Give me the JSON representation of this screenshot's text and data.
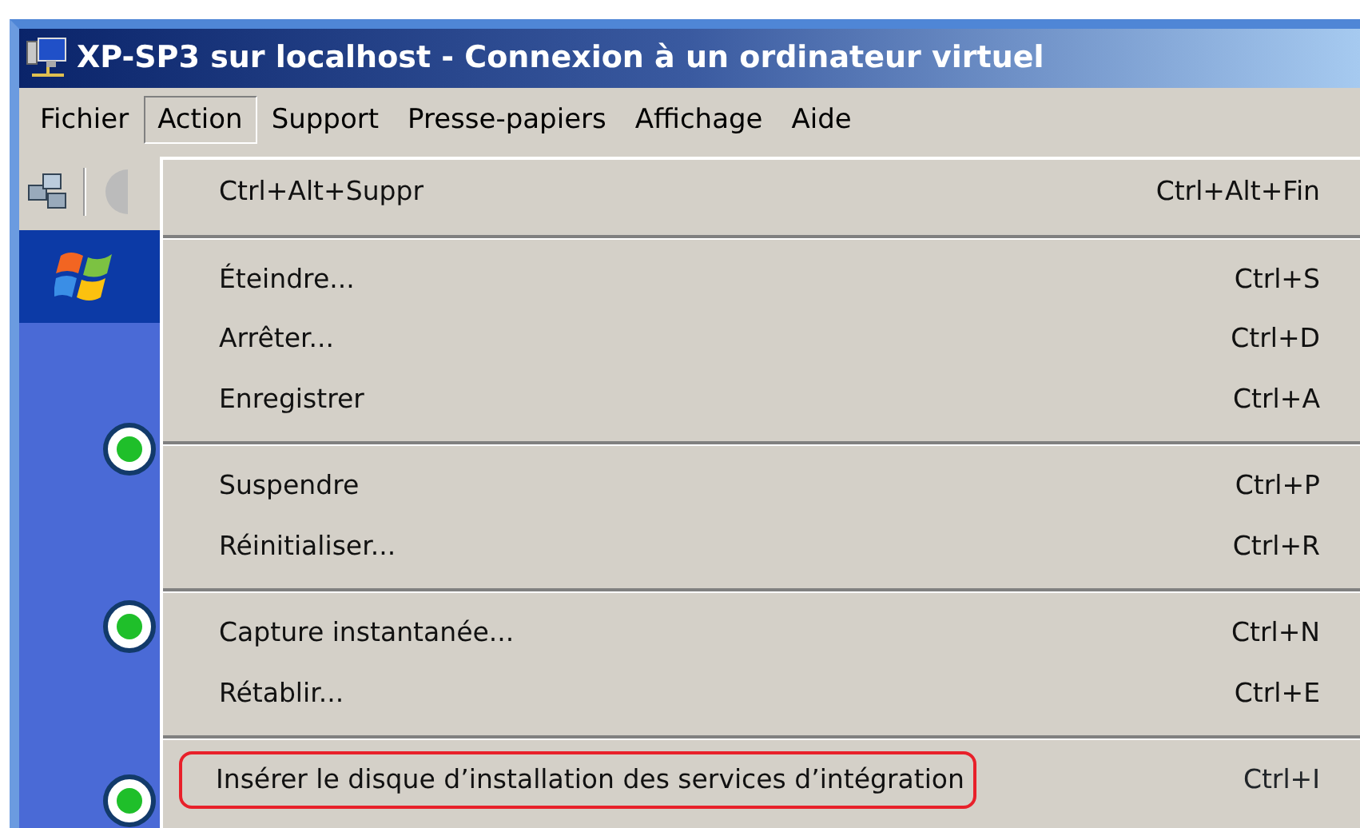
{
  "window": {
    "title": "XP-SP3 sur localhost - Connexion à un ordinateur virtuel"
  },
  "menu_bar": [
    {
      "label": "Fichier",
      "selected": false
    },
    {
      "label": "Action",
      "selected": true
    },
    {
      "label": "Support",
      "selected": false
    },
    {
      "label": "Presse-papiers",
      "selected": false
    },
    {
      "label": "Affichage",
      "selected": false
    },
    {
      "label": "Aide",
      "selected": false
    }
  ],
  "action_menu": {
    "groups": [
      [
        {
          "label": "Ctrl+Alt+Suppr",
          "shortcut": "Ctrl+Alt+Fin",
          "highlighted": false
        }
      ],
      [
        {
          "label": "Éteindre...",
          "shortcut": "Ctrl+S",
          "highlighted": false
        },
        {
          "label": "Arrêter...",
          "shortcut": "Ctrl+D",
          "highlighted": false
        },
        {
          "label": "Enregistrer",
          "shortcut": "Ctrl+A",
          "highlighted": false
        }
      ],
      [
        {
          "label": "Suspendre",
          "shortcut": "Ctrl+P",
          "highlighted": false
        },
        {
          "label": "Réinitialiser...",
          "shortcut": "Ctrl+R",
          "highlighted": false
        }
      ],
      [
        {
          "label": "Capture instantanée...",
          "shortcut": "Ctrl+N",
          "highlighted": false
        },
        {
          "label": "Rétablir...",
          "shortcut": "Ctrl+E",
          "highlighted": false
        }
      ],
      [
        {
          "label": "Insérer le disque d’installation des services d’intégration",
          "shortcut": "Ctrl+I",
          "highlighted": true
        }
      ]
    ]
  }
}
